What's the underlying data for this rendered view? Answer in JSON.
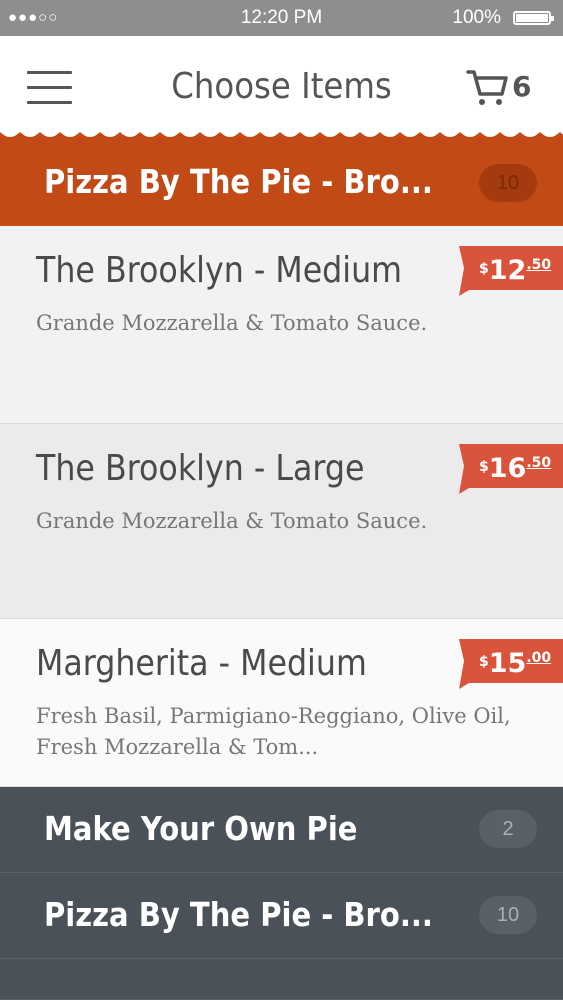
{
  "status_bar": {
    "signal": "●●●○○",
    "time": "12:20 PM",
    "battery": "100%"
  },
  "header": {
    "title": "Choose Items",
    "cart_count": "6",
    "menu_icon": "hamburger-menu-icon",
    "cart_icon": "shopping-cart-icon"
  },
  "active_category": {
    "title": "Pizza By The Pie - Bro...",
    "count": "10"
  },
  "items": [
    {
      "name": "The Brooklyn - Medium",
      "description": "Grande Mozzarella & Tomato Sauce.",
      "currency": "$",
      "price_dollars": "12",
      "price_cents": ".50"
    },
    {
      "name": "The Brooklyn - Large",
      "description": "Grande Mozzarella & Tomato Sauce.",
      "currency": "$",
      "price_dollars": "16",
      "price_cents": ".50"
    },
    {
      "name": "Margherita - Medium",
      "description": "Fresh Basil, Parmigiano-Reggiano, Olive Oil, Fresh Mozzarella & Tom...",
      "currency": "$",
      "price_dollars": "15",
      "price_cents": ".00"
    }
  ],
  "categories": [
    {
      "title": "Make Your Own Pie",
      "count": "2"
    },
    {
      "title": "Pizza By The Pie - Bro...",
      "count": "10"
    }
  ],
  "colors": {
    "accent": "#c14a17",
    "price_tag": "#d9543a",
    "dark_category": "#4b5158"
  }
}
